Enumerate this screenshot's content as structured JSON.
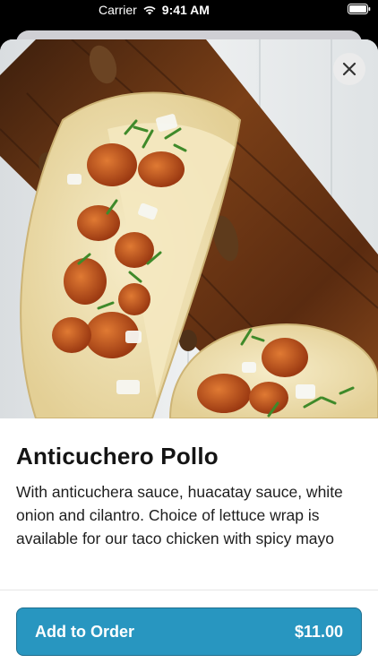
{
  "status_bar": {
    "carrier": "Carrier",
    "time": "9:41 AM",
    "wifi_icon": "wifi-icon",
    "battery_icon": "battery-icon"
  },
  "item": {
    "image_description_icon": "taco-photo",
    "title": "Anticuchero Pollo",
    "description": "With anticuchera sauce, huacatay sauce, white onion and cilantro. Choice of lettuce wrap is available for our taco chicken with spicy mayo",
    "close_icon": "close-icon"
  },
  "action": {
    "label": "Add to Order",
    "price": "$11.00",
    "color": "#2896c0"
  }
}
